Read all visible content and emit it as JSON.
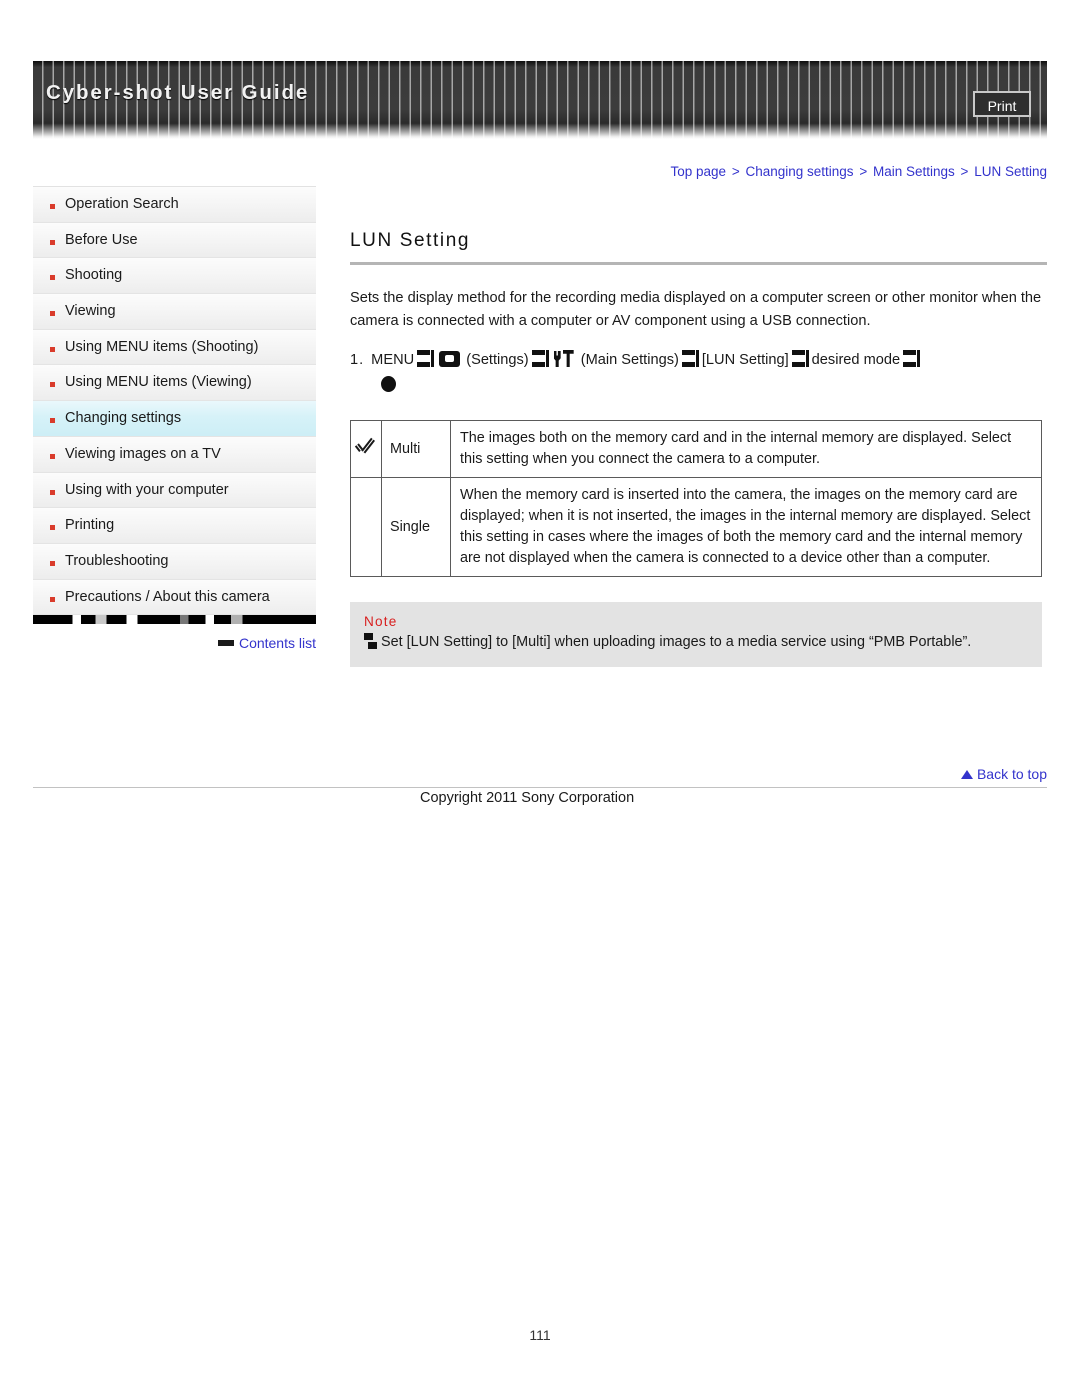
{
  "header": {
    "title": "Cyber-shot User Guide",
    "print_label": "Print"
  },
  "breadcrumb": {
    "items": [
      "Top page",
      "Changing settings",
      "Main Settings",
      "LUN Setting"
    ],
    "separator": ">"
  },
  "sidebar": {
    "items": [
      {
        "label": "Operation Search",
        "active": false
      },
      {
        "label": "Before Use",
        "active": false
      },
      {
        "label": "Shooting",
        "active": false
      },
      {
        "label": "Viewing",
        "active": false
      },
      {
        "label": "Using MENU items (Shooting)",
        "active": false
      },
      {
        "label": "Using MENU items (Viewing)",
        "active": false
      },
      {
        "label": "Changing settings",
        "active": true
      },
      {
        "label": "Viewing images on a TV",
        "active": false
      },
      {
        "label": "Using with your computer",
        "active": false
      },
      {
        "label": "Printing",
        "active": false
      },
      {
        "label": "Troubleshooting",
        "active": false
      },
      {
        "label": "Precautions / About this camera",
        "active": false
      }
    ],
    "contents_list_label": "Contents list"
  },
  "main": {
    "title": "LUN Setting",
    "intro": "Sets the display method for the recording media displayed on a computer screen or other monitor when the camera is connected with a computer or AV component using a USB connection.",
    "step": {
      "number": "1.",
      "menu_label": "MENU",
      "settings_label": "(Settings)",
      "main_settings_label": "(Main Settings)",
      "lun_setting_label": "[LUN Setting]",
      "desired_mode_label": "desired mode"
    },
    "options_table": {
      "rows": [
        {
          "checked": true,
          "name": "Multi",
          "description": "The images both on the memory card and in the internal memory are displayed. Select this setting when you connect the camera to a computer."
        },
        {
          "checked": false,
          "name": "Single",
          "description": "When the memory card is inserted into the camera, the images on the memory card are displayed; when it is not inserted, the images in the internal memory are displayed. Select this setting in cases where the images of both the memory card and the internal memory are not displayed when the camera is connected to a device other than a computer."
        }
      ]
    },
    "note": {
      "label": "Note",
      "text": "Set [LUN Setting] to [Multi] when uploading images to a media service using “PMB Portable”."
    }
  },
  "footer": {
    "back_to_top": "Back to top",
    "copyright": "Copyright 2011 Sony Corporation",
    "page_number": "111"
  },
  "colors": {
    "link": "#3333cc",
    "note_label": "#d81f1f",
    "sidebar_marker": "#d93b2b",
    "sidebar_active": "#cdeef6"
  }
}
